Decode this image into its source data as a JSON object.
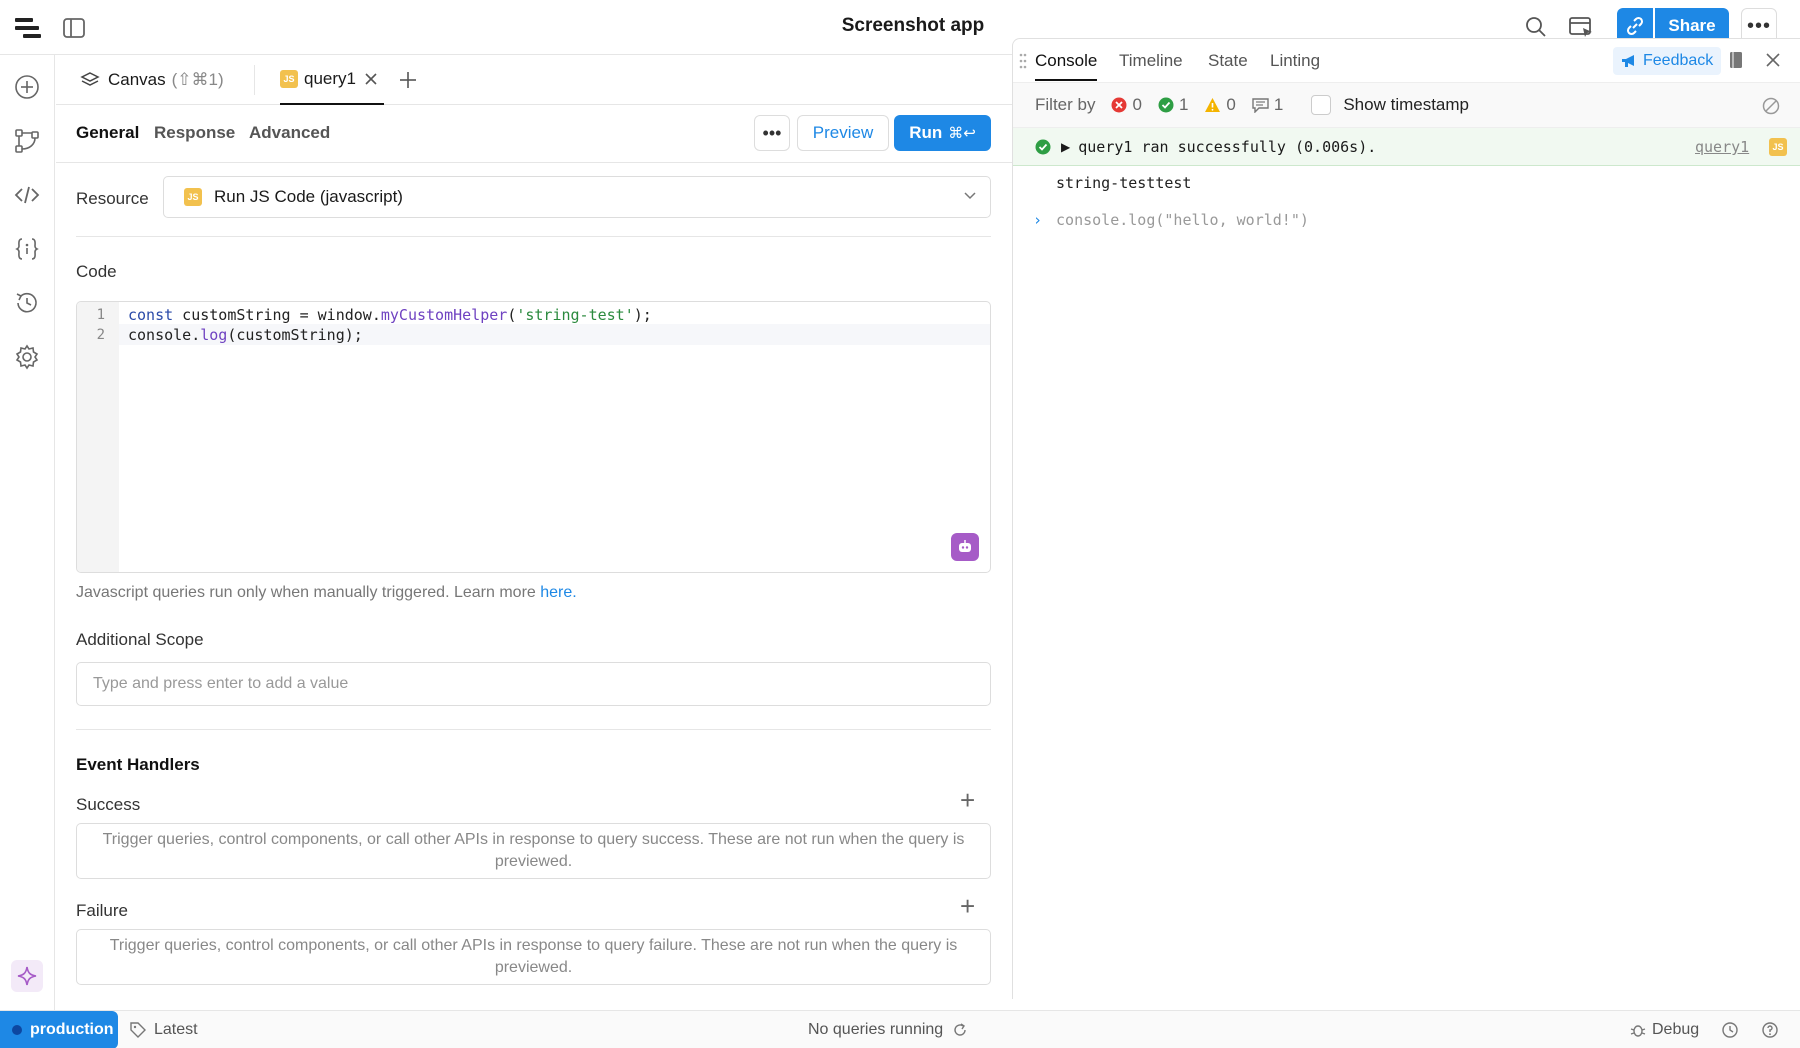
{
  "app": {
    "title": "Screenshot app"
  },
  "header": {
    "share_label": "Share",
    "more_label": "•••"
  },
  "editor": {
    "tabs": [
      {
        "label": "Canvas",
        "shortcut": "(⇧⌘1)"
      },
      {
        "label": "query1",
        "badge": "JS"
      }
    ],
    "subtabs": [
      "General",
      "Response",
      "Advanced"
    ],
    "dots_label": "•••",
    "preview_label": "Preview",
    "run_label": "Run",
    "run_shortcut": "⌘↩",
    "resource_label": "Resource",
    "resource_value": "Run JS Code (javascript)",
    "code_label": "Code",
    "code_lines": [
      {
        "num": "1",
        "text": "const customString = window.myCustomHelper('string-test');"
      },
      {
        "num": "2",
        "text": "console.log(customString);"
      }
    ],
    "help_text": "Javascript queries run only when manually triggered. Learn more ",
    "help_link": "here.",
    "scope_label": "Additional Scope",
    "scope_placeholder": "Type and press enter to add a value",
    "event_handlers_label": "Event Handlers",
    "success_label": "Success",
    "success_text": "Trigger queries, control components, or call other APIs in response to query success. These are not run when the query is previewed.",
    "failure_label": "Failure",
    "failure_text": "Trigger queries, control components, or call other APIs in response to query failure. These are not run when the query is previewed."
  },
  "console": {
    "tabs": [
      "Console",
      "Timeline",
      "State",
      "Linting"
    ],
    "feedback_label": "Feedback",
    "filter_label": "Filter by",
    "counts": {
      "errors": "0",
      "success": "1",
      "warnings": "0",
      "logs": "1"
    },
    "show_timestamp_label": "Show timestamp",
    "success_message": "query1 ran successfully (0.006s).",
    "success_link": "query1",
    "output": "string-testtest",
    "input": "console.log(\"hello, world!\")"
  },
  "status": {
    "environment": "production",
    "version": "Latest",
    "queries": "No queries running",
    "debug": "Debug"
  },
  "colors": {
    "accent": "#1e88e5",
    "success": "#2e9e44",
    "error": "#e53935",
    "warning": "#f4b400",
    "js_badge": "#f2c14e"
  }
}
